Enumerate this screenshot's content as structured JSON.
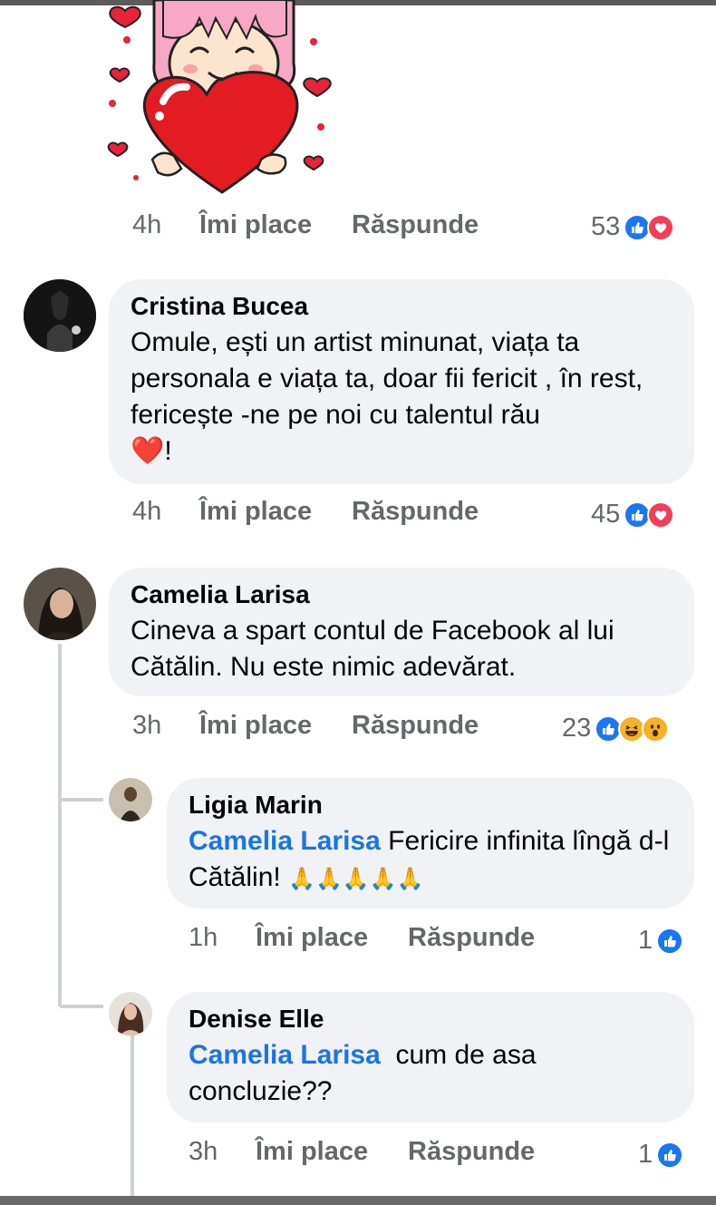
{
  "sticker": {
    "icon": "girl-holding-heart-sticker"
  },
  "first_meta": {
    "time": "4h",
    "like": "Îmi place",
    "reply": "Răspunde",
    "count": "53",
    "reactions": [
      "like",
      "love"
    ]
  },
  "comments": [
    {
      "author": "Cristina Bucea",
      "text": "Omule, ești un artist minunat, viața ta personala e viața ta, doar fii fericit , în rest, fericește -ne pe noi cu talentul rău",
      "emoji_tail": "❤️!",
      "time": "4h",
      "like": "Îmi place",
      "reply": "Răspunde",
      "count": "45",
      "reactions": [
        "like",
        "love"
      ]
    },
    {
      "author": "Camelia Larisa",
      "text": "Cineva a spart contul de Facebook al lui Cătălin. Nu  este nimic adevărat.",
      "time": "3h",
      "like": "Îmi place",
      "reply": "Răspunde",
      "count": "23",
      "reactions": [
        "like",
        "haha",
        "wow"
      ]
    }
  ],
  "replies": [
    {
      "author": "Ligia Marin",
      "mention": "Camelia Larisa",
      "text": " Fericire infinita lîngă d-l Cătălin! ",
      "emoji_tail": "🙏🙏🙏🙏🙏",
      "time": "1h",
      "like": "Îmi place",
      "reply": "Răspunde",
      "count": "1",
      "reactions": [
        "like"
      ]
    },
    {
      "author": "Denise Elle",
      "mention": "Camelia Larisa",
      "text": "  cum de asa concluzie??",
      "time": "3h",
      "like": "Îmi place",
      "reply": "Răspunde",
      "count": "1",
      "reactions": [
        "like"
      ]
    }
  ],
  "colors": {
    "mention": "#1b74e4",
    "bubble": "#f0f2f5",
    "meta": "#65676b",
    "like": "#1877f2",
    "love": "#f33e58",
    "haha": "#f7b125"
  }
}
